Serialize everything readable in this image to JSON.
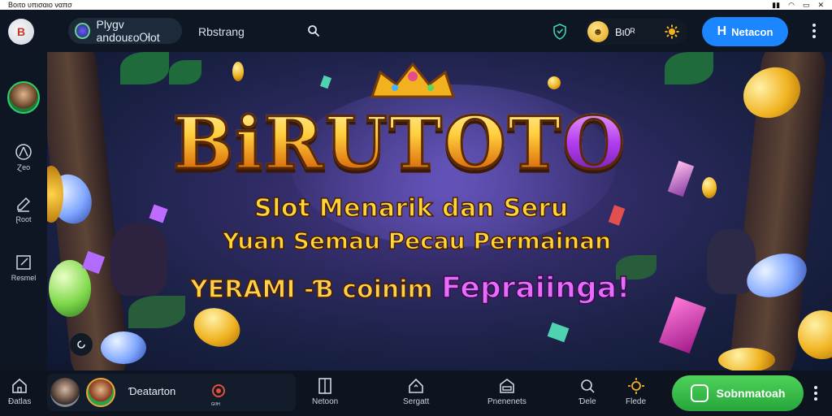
{
  "statusbar": {
    "left_text": "Βοιτο υπισαιο ναπσ"
  },
  "header": {
    "app_pill_label": "Plygv andouεoᎺot",
    "nav_label": "Rbstrang",
    "balance": "Bι0ᴿ",
    "login_label": "Netacon",
    "login_letter": "H",
    "logo_letter": "B"
  },
  "sidebar": {
    "items": [
      {
        "label": "Ɀeo",
        "icon": "triangle-icon"
      },
      {
        "label": "Ɽoot",
        "icon": "edit-icon"
      },
      {
        "label": "Resmel",
        "icon": "note-icon"
      }
    ]
  },
  "banner": {
    "title_main": "BiRUTOT",
    "title_last": "O",
    "line1": "Slot Menarik dan Seru",
    "line2": "Yuan Semau Pecau Permainan",
    "line3_a": "YERAMI -Ɓ coinim",
    "line3_b": "Fepraiinga!"
  },
  "bottombar": {
    "home_label": "Ɖatlas",
    "user_name": "Ɗeatarton",
    "user_sub": "ᴳ⁰ᴴ",
    "items": [
      {
        "label": "Netoon",
        "icon": "panel-icon"
      },
      {
        "label": "Sergatt",
        "icon": "house-icon"
      },
      {
        "label": "Pnenenets",
        "icon": "shop-icon"
      },
      {
        "label": "Ɗele",
        "icon": "search-icon"
      },
      {
        "label": "Flede",
        "icon": "sun-icon"
      }
    ],
    "cta_label": "Sobnmatoah"
  },
  "colors": {
    "accent_blue": "#1b86ff",
    "accent_green": "#25a53a",
    "gold": "#ffd63a",
    "purple": "#b23cf0"
  }
}
